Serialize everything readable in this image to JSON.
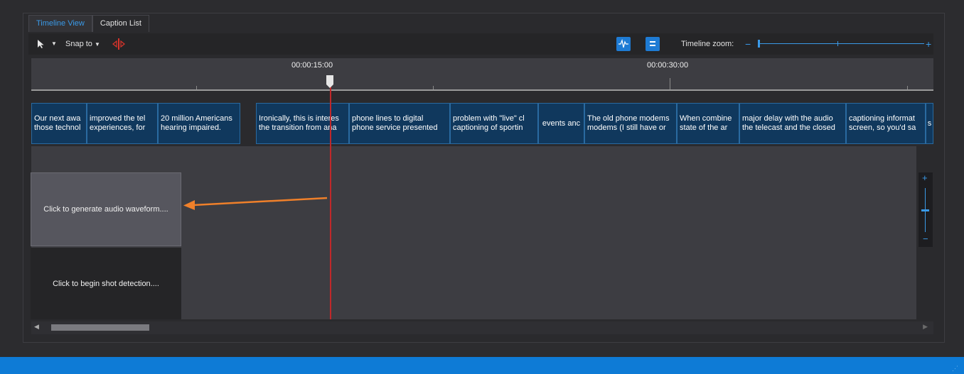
{
  "tabs": [
    {
      "label": "Timeline View",
      "active": true
    },
    {
      "label": "Caption List",
      "active": false
    }
  ],
  "toolbar": {
    "snap_label": "Snap to",
    "zoom_label": "Timeline zoom:",
    "zoom_level": 0.05
  },
  "ruler": {
    "labels": [
      "00:00:15:00",
      "00:00:30:00"
    ]
  },
  "captions": [
    {
      "lines": [
        "Our next awa",
        "those technol"
      ]
    },
    {
      "lines": [
        "improved the tel",
        "experiences, for"
      ]
    },
    {
      "lines": [
        "20 million Americans",
        "hearing impaired."
      ]
    },
    {
      "lines": [
        "Ironically, this is interes",
        "the transition from ana"
      ]
    },
    {
      "lines": [
        "phone lines to digital",
        "phone service presented"
      ]
    },
    {
      "lines": [
        "problem with \"live\" cl",
        "captioning of sportin"
      ]
    },
    {
      "lines": [
        "events anc"
      ]
    },
    {
      "lines": [
        "The old phone modems",
        "modems (I still have or"
      ]
    },
    {
      "lines": [
        "When combine",
        "state of the ar"
      ]
    },
    {
      "lines": [
        "major delay with the audio",
        "the telecast and the closed"
      ]
    },
    {
      "lines": [
        "captioning informat",
        "screen, so you'd sa"
      ]
    },
    {
      "lines": [
        "s"
      ]
    }
  ],
  "tracks": {
    "waveform_label": "Click to generate audio waveform....",
    "shot_label": "Click to begin shot detection...."
  },
  "colors": {
    "accent": "#1e7bd4",
    "caption_bg": "#10385d",
    "playhead": "#c0282a",
    "annotation_arrow": "#f0802a",
    "statusbar": "#0e7bd6"
  }
}
